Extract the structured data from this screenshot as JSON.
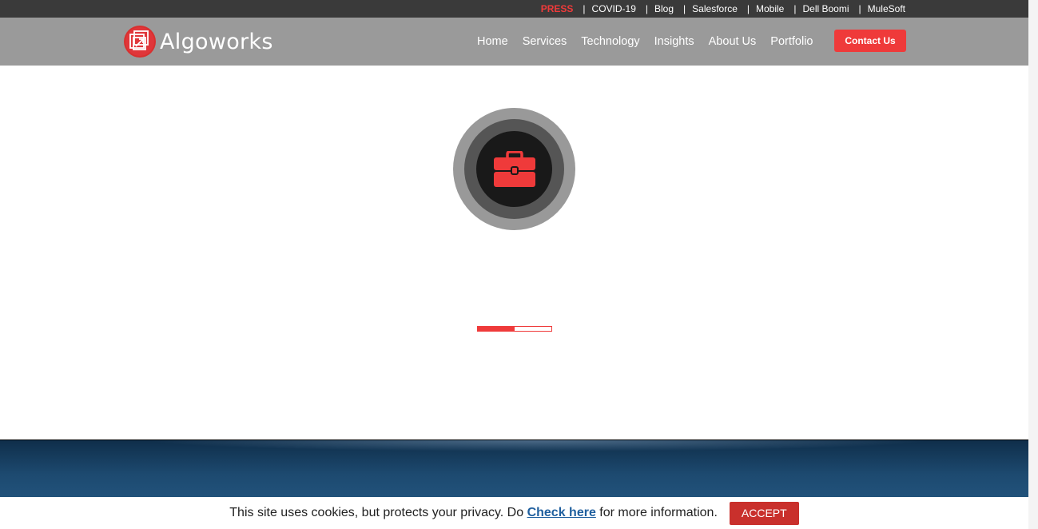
{
  "topbar": {
    "press": "PRESS",
    "separator": "|",
    "links": [
      "COVID-19",
      "Blog",
      "Salesforce",
      "Mobile",
      "Dell Boomi",
      "MuleSoft"
    ]
  },
  "header": {
    "logo_text": "Algoworks",
    "nav": [
      "Home",
      "Services",
      "Technology",
      "Insights",
      "About Us",
      "Portfolio"
    ],
    "contact_label": "Contact Us"
  },
  "loader": {
    "icon": "briefcase-icon",
    "progress": 0.5
  },
  "cookie": {
    "text_before": "This site uses cookies, but protects your privacy. Do ",
    "link_text": "Check here",
    "text_after": " for more information.",
    "accept_label": "ACCEPT"
  },
  "colors": {
    "accent": "#ef3a3a",
    "topbar_bg": "#3a3a3a",
    "header_bg": "#9a9a9a",
    "band": "#1d4a70",
    "accept": "#c9302c"
  }
}
